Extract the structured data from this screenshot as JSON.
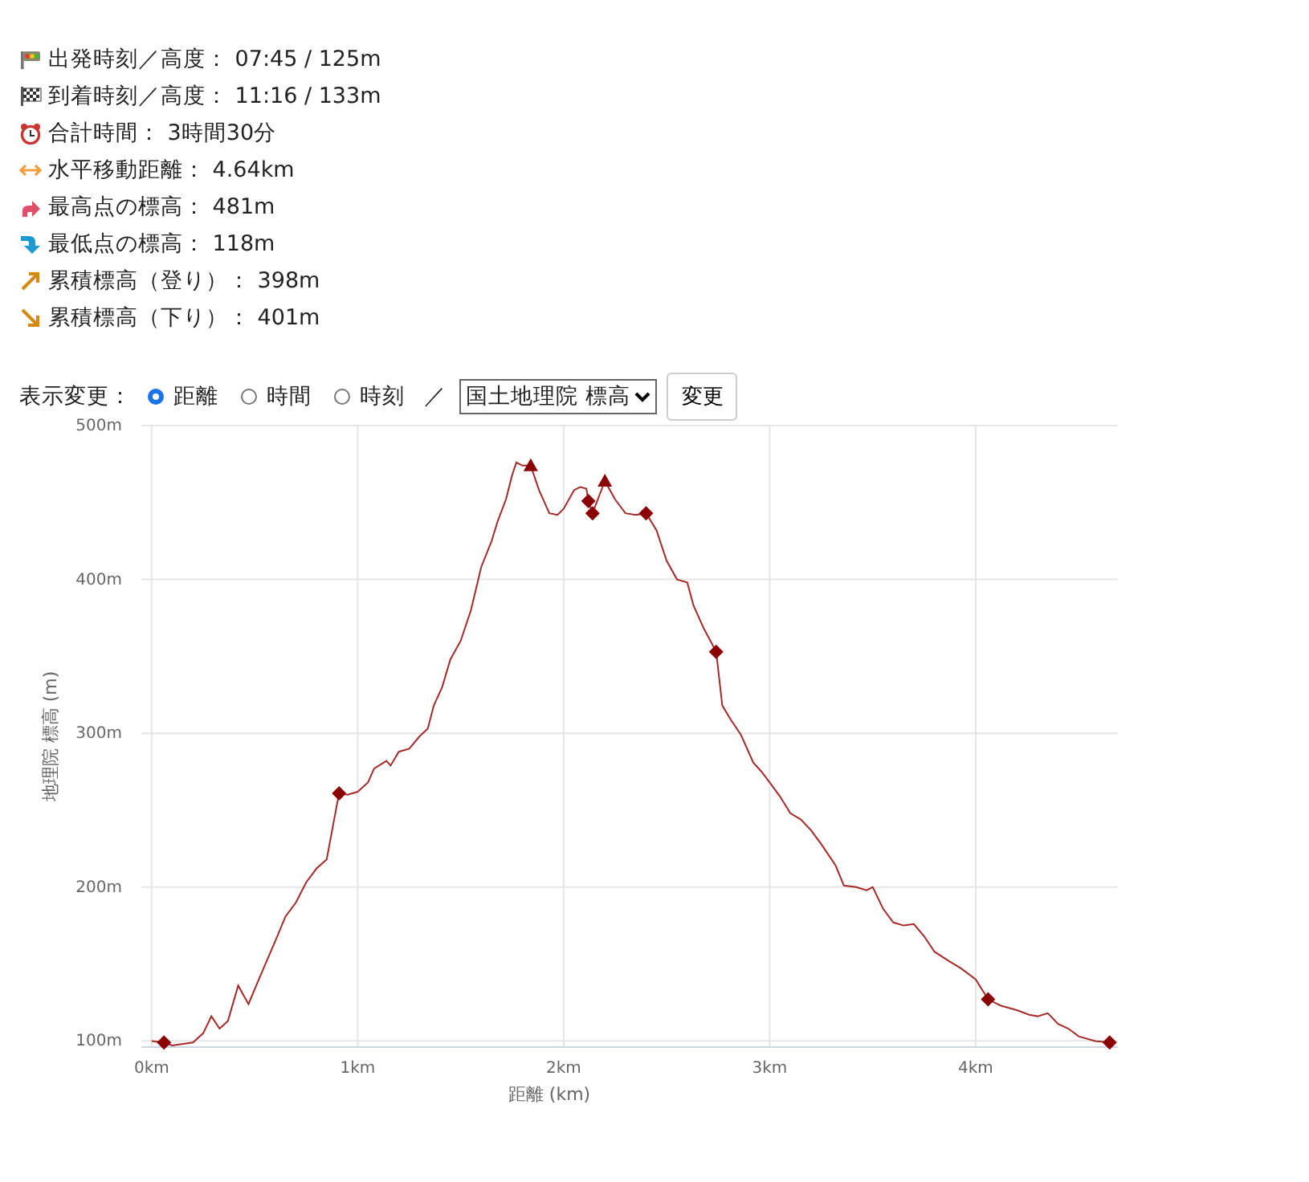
{
  "stats": [
    {
      "kind": "start-flag",
      "text": "出発時刻／高度： 07:45 / 125m"
    },
    {
      "kind": "goal-flag",
      "text": "到着時刻／高度： 11:16 / 133m"
    },
    {
      "kind": "clock",
      "text": "合計時間： 3時間30分"
    },
    {
      "kind": "distance",
      "text": "水平移動距離： 4.64km"
    },
    {
      "kind": "highest",
      "text": "最高点の標高： 481m"
    },
    {
      "kind": "lowest",
      "text": "最低点の標高： 118m"
    },
    {
      "kind": "ascent",
      "text": "累積標高（登り）： 398m"
    },
    {
      "kind": "descent",
      "text": "累積標高（下り）： 401m"
    }
  ],
  "display_controls": {
    "label": "表示変更：",
    "options": [
      {
        "label": "距離",
        "selected": true
      },
      {
        "label": "時間",
        "selected": false
      },
      {
        "label": "時刻",
        "selected": false
      }
    ],
    "separator": "／",
    "source_select": "国土地理院 標高",
    "button": "変更"
  },
  "chart": {
    "chart_data": {
      "type": "line",
      "grid": true,
      "xlabel": "距離 (km)",
      "ylabel": "地理院 標高 (m)",
      "xlim": [
        -0.05,
        4.69
      ],
      "ylim": [
        96,
        500
      ],
      "xticks": [
        {
          "value": 0,
          "label": "0km"
        },
        {
          "value": 1,
          "label": "1km"
        },
        {
          "value": 2,
          "label": "2km"
        },
        {
          "value": 3,
          "label": "3km"
        },
        {
          "value": 4,
          "label": "4km"
        }
      ],
      "yticks": [
        {
          "value": 100,
          "label": "100m"
        },
        {
          "value": 200,
          "label": "200m"
        },
        {
          "value": 300,
          "label": "300m"
        },
        {
          "value": 400,
          "label": "400m"
        },
        {
          "value": 500,
          "label": "500m"
        }
      ],
      "x": [
        0,
        0.06,
        0.1,
        0.2,
        0.25,
        0.29,
        0.33,
        0.37,
        0.42,
        0.47,
        0.52,
        0.6,
        0.65,
        0.7,
        0.75,
        0.8,
        0.85,
        0.91,
        0.95,
        1.0,
        1.05,
        1.08,
        1.14,
        1.16,
        1.2,
        1.25,
        1.3,
        1.34,
        1.37,
        1.41,
        1.45,
        1.5,
        1.55,
        1.6,
        1.65,
        1.68,
        1.72,
        1.75,
        1.77,
        1.8,
        1.84,
        1.88,
        1.93,
        1.97,
        2.0,
        2.05,
        2.08,
        2.11,
        2.12,
        2.14,
        2.2,
        2.25,
        2.3,
        2.35,
        2.4,
        2.45,
        2.5,
        2.55,
        2.6,
        2.63,
        2.68,
        2.74,
        2.77,
        2.81,
        2.86,
        2.92,
        2.96,
        3.0,
        3.05,
        3.1,
        3.15,
        3.2,
        3.25,
        3.32,
        3.36,
        3.42,
        3.47,
        3.5,
        3.55,
        3.6,
        3.65,
        3.7,
        3.75,
        3.8,
        3.87,
        3.93,
        4.0,
        4.06,
        4.12,
        4.2,
        4.26,
        4.3,
        4.35,
        4.4,
        4.45,
        4.5,
        4.58,
        4.65
      ],
      "series": [
        {
          "color": "#a52a2a",
          "values": [
            100,
            99,
            97,
            99,
            105,
            116,
            108,
            113,
            136,
            124,
            140,
            165,
            181,
            190,
            203,
            212,
            218,
            261,
            260,
            262,
            268,
            277,
            282,
            279,
            288,
            290,
            298,
            303,
            318,
            330,
            348,
            360,
            380,
            408,
            425,
            438,
            452,
            468,
            476,
            474,
            474,
            458,
            443,
            442,
            446,
            458,
            460,
            459,
            451,
            443,
            464,
            452,
            443,
            442,
            443,
            432,
            412,
            400,
            398,
            383,
            368,
            353,
            318,
            309,
            299,
            281,
            275,
            268,
            259,
            248,
            244,
            237,
            228,
            214,
            201,
            200,
            198,
            200,
            186,
            177,
            175,
            176,
            168,
            158,
            152,
            147,
            140,
            127,
            123,
            120,
            117,
            116,
            118,
            111,
            108,
            103,
            100,
            99
          ]
        },
        {
          "color": "#8b0000",
          "type": "scatter",
          "marker": "diamond",
          "values": [
            null,
            99,
            null,
            null,
            null,
            null,
            null,
            null,
            null,
            null,
            null,
            null,
            null,
            null,
            null,
            null,
            null,
            261,
            null,
            null,
            null,
            null,
            null,
            null,
            null,
            null,
            null,
            null,
            null,
            null,
            null,
            null,
            null,
            null,
            null,
            null,
            null,
            null,
            null,
            null,
            null,
            null,
            null,
            null,
            null,
            null,
            null,
            null,
            451,
            443,
            null,
            null,
            null,
            null,
            443,
            null,
            null,
            null,
            null,
            null,
            null,
            353,
            null,
            null,
            null,
            null,
            null,
            null,
            null,
            null,
            null,
            null,
            null,
            null,
            null,
            null,
            null,
            null,
            null,
            null,
            null,
            null,
            null,
            null,
            null,
            null,
            null,
            127,
            null,
            null,
            null,
            null,
            null,
            null,
            null,
            null,
            null,
            99
          ]
        },
        {
          "color": "#8b0000",
          "type": "scatter",
          "marker": "triangle",
          "values": [
            null,
            null,
            null,
            null,
            null,
            null,
            null,
            null,
            null,
            null,
            null,
            null,
            null,
            null,
            null,
            null,
            null,
            null,
            null,
            null,
            null,
            null,
            null,
            null,
            null,
            null,
            null,
            null,
            null,
            null,
            null,
            null,
            null,
            null,
            null,
            null,
            null,
            null,
            null,
            null,
            474,
            null,
            null,
            null,
            null,
            null,
            null,
            null,
            null,
            null,
            464,
            null,
            null,
            null,
            null,
            null,
            null,
            null,
            null,
            null,
            null,
            null,
            null,
            null,
            null,
            null,
            null,
            null,
            null,
            null,
            null,
            null,
            null,
            null,
            null,
            null,
            null,
            null,
            null,
            null,
            null,
            null,
            null,
            null,
            null,
            null,
            null,
            null,
            null,
            null,
            null,
            null,
            null,
            null,
            null,
            null,
            null,
            null
          ]
        }
      ]
    }
  }
}
